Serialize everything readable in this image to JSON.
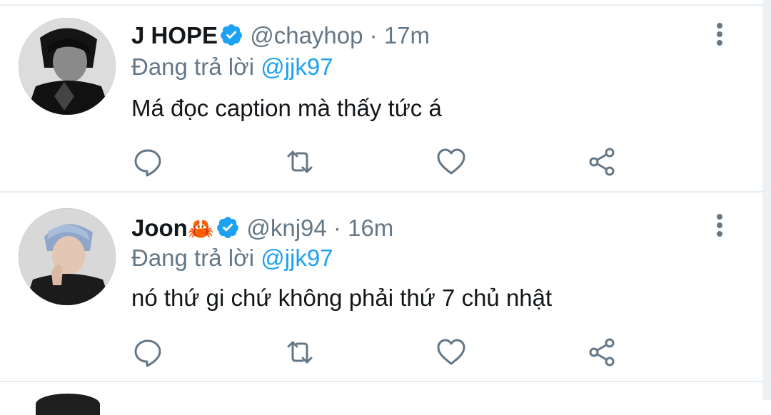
{
  "tweets": [
    {
      "name": "J HOPE",
      "emoji": "",
      "handle": "@chayhop",
      "separator": "·",
      "time": "17m",
      "replying_prefix": "Đang trả lời",
      "replying_to": "@jjk97",
      "text": "Má đọc caption mà thấy tức á",
      "avatar_style": "grayscale"
    },
    {
      "name": "Joon",
      "emoji": "🦀",
      "handle": "@knj94",
      "separator": "·",
      "time": "16m",
      "replying_prefix": "Đang trả lời",
      "replying_to": "@jjk97",
      "text": "nó thứ gi chứ không phải thứ 7 chủ nhật",
      "avatar_style": "color"
    }
  ],
  "icons": {
    "verified": "verified-badge-icon",
    "more": "more-vertical-icon",
    "reply": "reply-icon",
    "retweet": "retweet-icon",
    "like": "heart-icon",
    "share": "share-icon"
  },
  "colors": {
    "accent": "#1da1f2",
    "secondary_text": "#657786",
    "primary_text": "#14171a",
    "divider": "#e6ecf0"
  }
}
